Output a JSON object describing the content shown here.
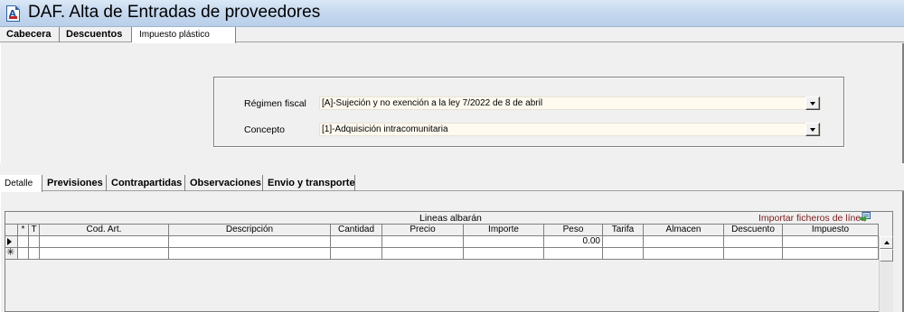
{
  "window": {
    "title": "DAF. Alta de Entradas de proveedores",
    "icon": "document-app-icon"
  },
  "top_tabs": [
    {
      "label": "Cabecera",
      "active": false
    },
    {
      "label": "Descuentos",
      "active": false
    },
    {
      "label": "Impuesto plástico",
      "active": true
    }
  ],
  "form": {
    "regimen_label": "Régimen fiscal",
    "regimen_value": "[A]-Sujeción y no exención a la ley 7/2022 de 8 de abril",
    "concepto_label": "Concepto",
    "concepto_value": "[1]-Adquisición intracomunitaria"
  },
  "bottom_tabs": [
    {
      "label": "Detalle",
      "active": true
    },
    {
      "label": "Previsiones",
      "active": false
    },
    {
      "label": "Contrapartidas",
      "active": false
    },
    {
      "label": "Observaciones",
      "active": false
    },
    {
      "label": "Envio y transporte",
      "active": false
    }
  ],
  "grid": {
    "caption": "Lineas albarán",
    "import_link": "Importar ficheros de línea",
    "import_icon": "import-file-icon",
    "columns": [
      "*",
      "T",
      "Cod. Art.",
      "Descripción",
      "Cantidad",
      "Precio",
      "Importe",
      "Peso",
      "Tarifa",
      "Almacen",
      "Descuento",
      "Impuesto"
    ],
    "rows": [
      {
        "indicator": "current-row-arrow-icon",
        "peso": "0.00"
      },
      {
        "indicator": "new-row-asterisk-icon",
        "peso": ""
      }
    ],
    "new_row_symbol": "✳"
  }
}
